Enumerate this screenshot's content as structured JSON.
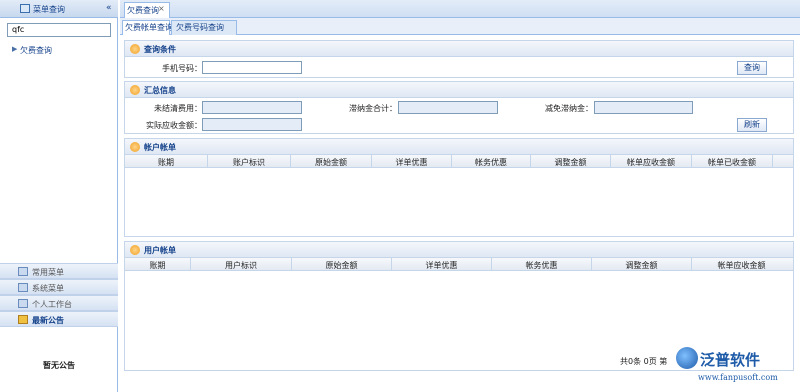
{
  "sidebar": {
    "title": "菜单查询",
    "collapse": "«",
    "search_value": "qfc",
    "tree_item": "欠费查询",
    "accordion": [
      "常用菜单",
      "系统菜单",
      "个人工作台",
      "最新公告"
    ],
    "notice_text": "暂无公告"
  },
  "tabs": {
    "main_label": "欠费查询",
    "close": "×"
  },
  "subtabs": [
    "欠费帐单查询",
    "欠费号码查询"
  ],
  "query": {
    "title": "查询条件",
    "phone_label": "手机号码：",
    "phone_value": "",
    "query_button": "查询"
  },
  "summary": {
    "title": "汇总信息",
    "unsettled_label": "未结清费用：",
    "late_fee_label": "滞纳金合计：",
    "waive_label": "减免滞纳金：",
    "actual_label": "实际应收金额：",
    "refresh_button": "刷新"
  },
  "account_bill": {
    "title": "帐户帐单",
    "columns": [
      "账期",
      "账户标识",
      "原始金额",
      "详单优惠",
      "帐务优惠",
      "调整金额",
      "帐单应收金额",
      "帐单已收金额"
    ]
  },
  "user_bill": {
    "title": "用户帐单",
    "columns": [
      "账期",
      "用户标识",
      "原始金额",
      "详单优惠",
      "帐务优惠",
      "调整金额",
      "帐单应收金额"
    ]
  },
  "pager": {
    "text": "共0条  0页  第"
  },
  "logo": {
    "name": "泛普软件",
    "url": "www.fanpusoft.com"
  }
}
